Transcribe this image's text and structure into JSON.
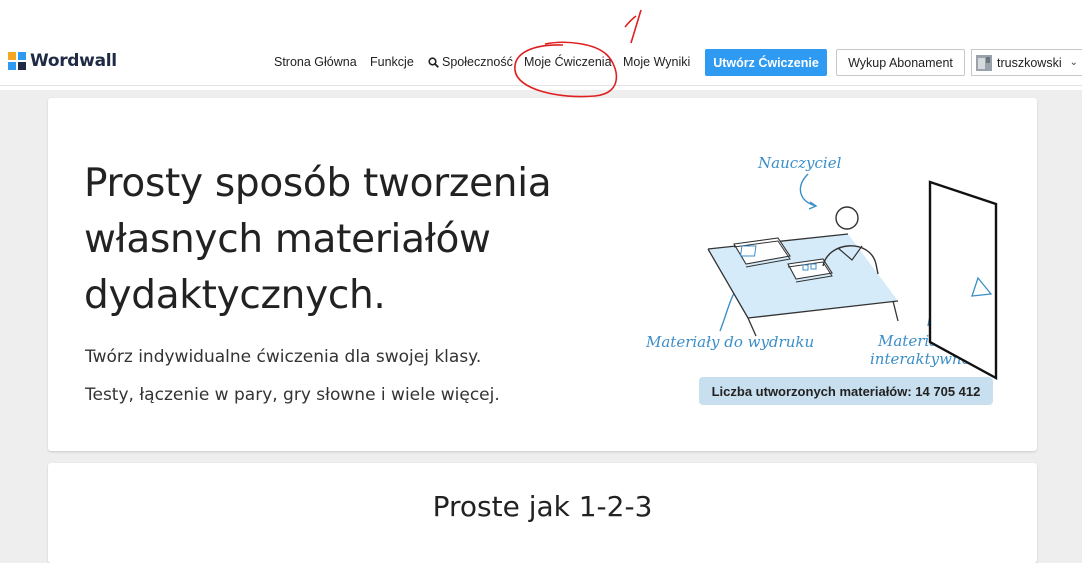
{
  "header": {
    "logo_text": "Wordwall",
    "nav": {
      "home": "Strona Główna",
      "features": "Funkcje",
      "community": "Społeczność",
      "my_activities": "Moje Ćwiczenia",
      "my_results": "Moje Wyniki"
    },
    "create_button": "Utwórz Ćwiczenie",
    "subscribe_button": "Wykup Abonament",
    "username": "truszkowski"
  },
  "hero": {
    "title": "Prosty sposób tworzenia własnych materiałów dydaktycznych.",
    "line1": "Twórz indywidualne ćwiczenia dla swojej klasy.",
    "line2": "Testy, łączenie w pary, gry słowne i wiele więcej.",
    "illustration": {
      "teacher_label": "Nauczyciel",
      "printables_label": "Materiały do wydruku",
      "interactive_label_line1": "Materiały",
      "interactive_label_line2": "interaktywne"
    },
    "count_badge": "Liczba utworzonych materiałów: 14 705 412"
  },
  "section2": {
    "title": "Proste jak 1-2-3"
  },
  "colors": {
    "accent": "#2e9af2",
    "illustration_blue": "#3b8fc8",
    "badge_bg": "#c8dff0",
    "annotation_red": "#e02020"
  }
}
